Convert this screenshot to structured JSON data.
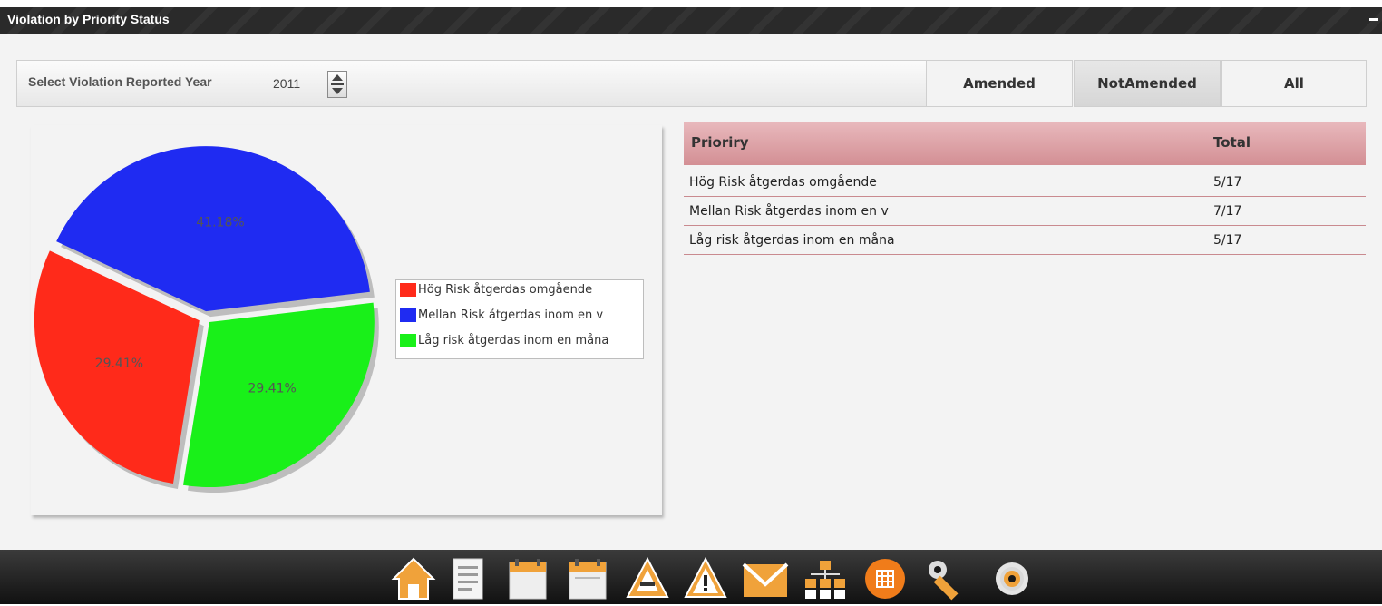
{
  "window": {
    "title": "Violation by Priority Status"
  },
  "filter": {
    "label": "Select Violation Reported Year",
    "year": "2011"
  },
  "tabs": [
    {
      "label": "Amended",
      "active": false
    },
    {
      "label": "NotAmended",
      "active": true
    },
    {
      "label": "All",
      "active": false
    }
  ],
  "chart_data": {
    "type": "pie",
    "labels": [
      "Hög Risk åtgerdas omgående",
      "Mellan Risk åtgerdas inom en v",
      "Låg risk åtgerdas inom en måna"
    ],
    "values": [
      29.41,
      41.18,
      29.41
    ],
    "data_labels": [
      "29.41%",
      "41.18%",
      "29.41%"
    ],
    "colors": [
      "#ff2a1a",
      "#1f2bf2",
      "#19f019"
    ],
    "legend_position": "right"
  },
  "table": {
    "headers": [
      "Prioriry",
      "Total"
    ],
    "rows": [
      [
        "Hög Risk åtgerdas omgående",
        "5/17"
      ],
      [
        "Mellan Risk åtgerdas inom en v",
        "7/17"
      ],
      [
        "Låg risk åtgerdas inom en måna",
        "5/17"
      ]
    ]
  },
  "dock": [
    {
      "icon": "home-icon"
    },
    {
      "icon": "document-icon"
    },
    {
      "icon": "calendar-icon"
    },
    {
      "icon": "audit-calendar-icon"
    },
    {
      "icon": "warning-outline-icon"
    },
    {
      "icon": "warning-icon"
    },
    {
      "icon": "mail-icon"
    },
    {
      "icon": "org-chart-icon"
    },
    {
      "icon": "grid-icon"
    },
    {
      "icon": "wrench-icon"
    },
    {
      "icon": "gear-icon"
    }
  ]
}
